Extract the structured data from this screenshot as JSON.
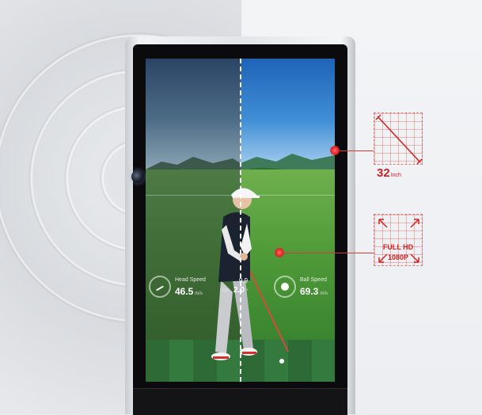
{
  "screen": {
    "hud_left": {
      "title": "Head Speed",
      "value": "46.5",
      "unit": "m/s"
    },
    "hud_mid": {
      "top_value": "9.9",
      "value": "2.0",
      "value_unit": "°",
      "label": "ngle"
    },
    "hud_right": {
      "title": "Ball Speed",
      "value": "69.3",
      "unit": "m/s"
    }
  },
  "specs": {
    "size_value": "32",
    "size_unit": "Inch",
    "resolution_line1": "FULL HD",
    "resolution_line2": "1080P"
  },
  "colors": {
    "accent": "#d32020",
    "screen_divider": "#ffffff"
  }
}
